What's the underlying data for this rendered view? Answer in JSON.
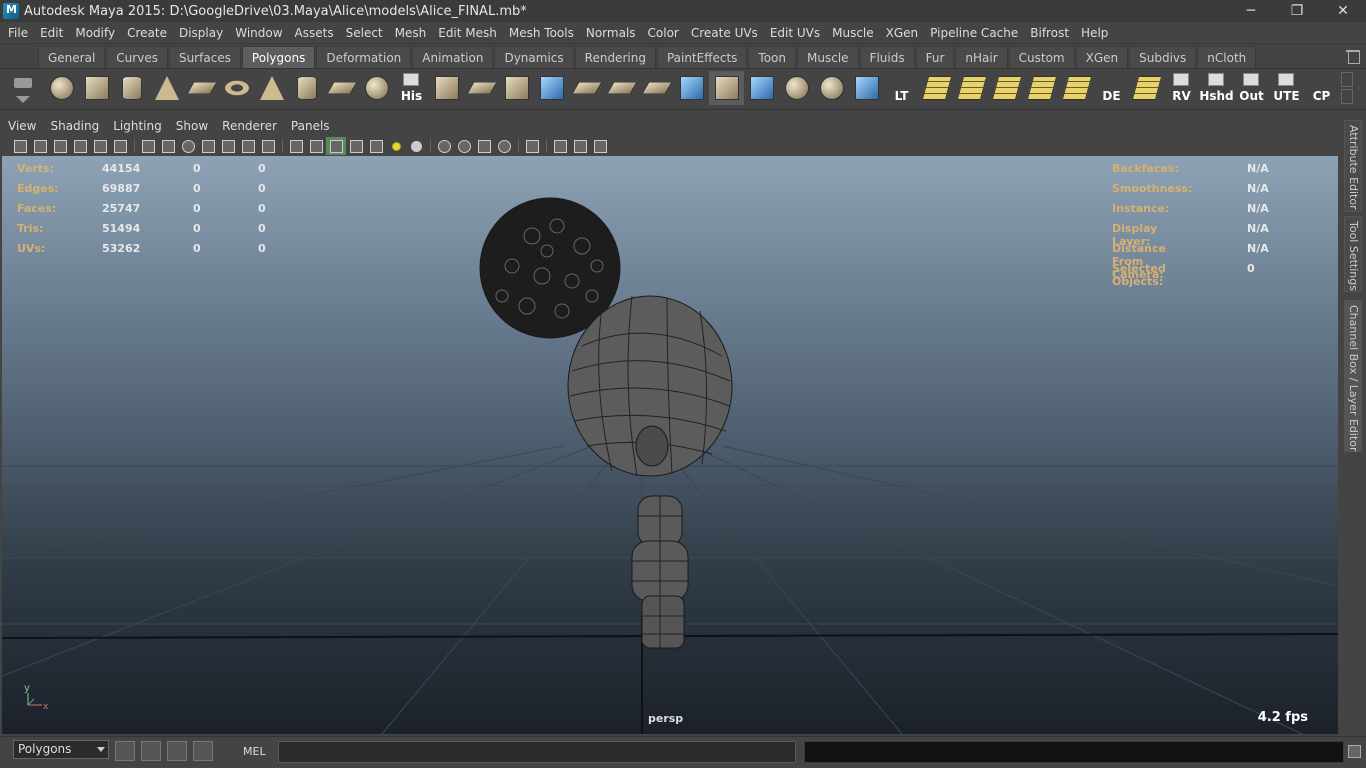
{
  "window": {
    "title": "Autodesk Maya 2015: D:\\GoogleDrive\\03.Maya\\Alice\\models\\Alice_FINAL.mb*",
    "minimize": "─",
    "maximize": "❐",
    "close": "✕"
  },
  "menubar": [
    "File",
    "Edit",
    "Modify",
    "Create",
    "Display",
    "Window",
    "Assets",
    "Select",
    "Mesh",
    "Edit Mesh",
    "Mesh Tools",
    "Normals",
    "Color",
    "Create UVs",
    "Edit UVs",
    "Muscle",
    "XGen",
    "Pipeline Cache",
    "Bifrost",
    "Help"
  ],
  "shelf": {
    "tabs": [
      "General",
      "Curves",
      "Surfaces",
      "Polygons",
      "Deformation",
      "Animation",
      "Dynamics",
      "Rendering",
      "PaintEffects",
      "Toon",
      "Muscle",
      "Fluids",
      "Fur",
      "nHair",
      "Custom",
      "XGen",
      "Subdivs",
      "nCloth"
    ],
    "active_tab": "Polygons",
    "text_buttons": {
      "his": "His",
      "lt": "LT",
      "de": "DE",
      "rv": "RV",
      "hshd": "Hshd",
      "out": "Out",
      "ute": "UTE",
      "cp": "CP"
    }
  },
  "panel": {
    "menus": [
      "View",
      "Shading",
      "Lighting",
      "Show",
      "Renderer",
      "Panels"
    ]
  },
  "hud": {
    "left": [
      {
        "label": "Verts:",
        "v1": "44154",
        "v2": "0",
        "v3": "0"
      },
      {
        "label": "Edges:",
        "v1": "69887",
        "v2": "0",
        "v3": "0"
      },
      {
        "label": "Faces:",
        "v1": "25747",
        "v2": "0",
        "v3": "0"
      },
      {
        "label": "Tris:",
        "v1": "51494",
        "v2": "0",
        "v3": "0"
      },
      {
        "label": "UVs:",
        "v1": "53262",
        "v2": "0",
        "v3": "0"
      }
    ],
    "right": [
      {
        "label": "Backfaces:",
        "value": "N/A"
      },
      {
        "label": "Smoothness:",
        "value": "N/A"
      },
      {
        "label": "Instance:",
        "value": "N/A"
      },
      {
        "label": "Display Layer:",
        "value": "N/A"
      },
      {
        "label": "Distance From Camera:",
        "value": "N/A"
      },
      {
        "label": "Selected Objects:",
        "value": "0"
      }
    ],
    "camera": "persp",
    "fps": "4.2 fps",
    "axis_label_y": "y",
    "axis_label_x": "x"
  },
  "right_dock_tabs": [
    "Attribute Editor",
    "Tool Settings",
    "Channel Box / Layer Editor"
  ],
  "commandline": {
    "mode": "Polygons",
    "mel_label": "MEL"
  },
  "colors": {
    "hud_label": "#d8b071",
    "wire": "#111111",
    "active_tab": "#5d5d5d"
  }
}
